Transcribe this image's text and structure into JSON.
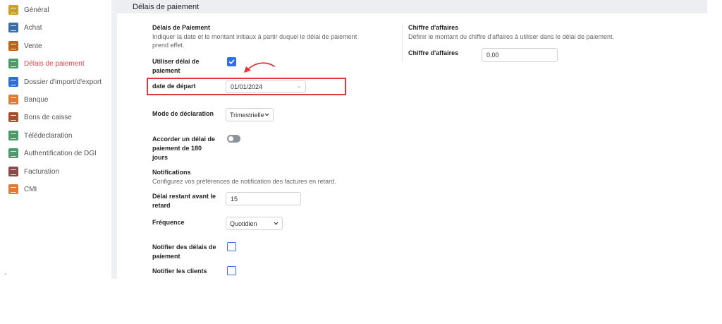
{
  "sidebar": {
    "items": [
      {
        "label": "Général",
        "icon": "settings-icon",
        "color": "#c9a227"
      },
      {
        "label": "Achat",
        "icon": "credit-card-icon",
        "color": "#3a6ea5"
      },
      {
        "label": "Vente",
        "icon": "chart-icon",
        "color": "#b5651d"
      },
      {
        "label": "Délais de paiement",
        "icon": "ledger-icon",
        "color": "#4a9a6a",
        "active": true
      },
      {
        "label": "Dossier d'import/d'export",
        "icon": "folder-icon",
        "color": "#2a6fd6"
      },
      {
        "label": "Banque",
        "icon": "bank-icon",
        "color": "#e07a3a"
      },
      {
        "label": "Bons de caisse",
        "icon": "receipt-icon",
        "color": "#a0522d"
      },
      {
        "label": "Télédeclaration",
        "icon": "ledger-icon",
        "color": "#4a9a6a"
      },
      {
        "label": "Authentification de DGI",
        "icon": "ledger-icon",
        "color": "#4a9a6a"
      },
      {
        "label": "Facturation",
        "icon": "tag-icon",
        "color": "#8b4a4a"
      },
      {
        "label": "CMI",
        "icon": "moon-icon",
        "color": "#e07a3a"
      }
    ],
    "tick": "^"
  },
  "header": {
    "title": "Délais de paiement"
  },
  "delais": {
    "title": "Délais de Paiement",
    "description_line1": "Indiquer la date et le montant initiaux à partir duquel le délai de paiement",
    "description_line2": "prend effet.",
    "use_label_line1": "Utiliser délai de",
    "use_label_line2": "paiement",
    "use_checked": true,
    "start_label": "date de départ",
    "start_value": "01/01/2024",
    "mode_label": "Mode de déclaration",
    "mode_value": "Trimestrielle",
    "grant_label_line1": "Accorder un délai de",
    "grant_label_line2": "paiement de 180",
    "grant_label_line3": "jours",
    "grant_on": false
  },
  "notifications": {
    "title": "Notifications",
    "description": "Configurez vos préférences de notification des factures en retard.",
    "remaining_label_line1": "Délai restant avant le",
    "remaining_label_line2": "retard",
    "remaining_value": "15",
    "frequency_label": "Fréquence",
    "frequency_value": "Quotidien",
    "notify_delays_label_line1": "Notifier des délais de",
    "notify_delays_label_line2": "paiement",
    "notify_delays_checked": false,
    "notify_clients_label": "Notifier les clients",
    "notify_clients_checked": false
  },
  "turnover": {
    "title": "Chiffre d'affaires",
    "description": "Définir le montant du chiffre d'affaires à utiliser dans le délai de paiement.",
    "field_label": "Chiffre d'affaires",
    "field_value": "0,00"
  },
  "colors": {
    "accent": "#2e6fe6",
    "active_text": "#e84545",
    "highlight": "#e5353c",
    "header_bg": "#eceef1"
  }
}
